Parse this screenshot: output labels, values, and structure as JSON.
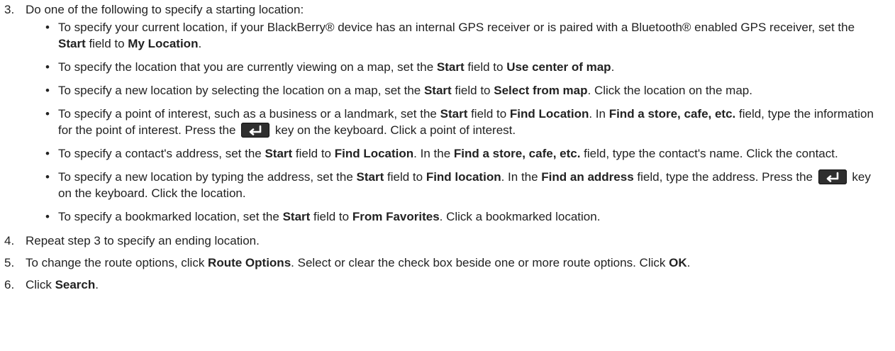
{
  "step3": {
    "number": "3.",
    "text": "Do one of the following to specify a starting location:",
    "bullets": [
      {
        "p1": "To specify your current location, if your BlackBerry® device has an internal GPS receiver or is paired with a Bluetooth® enabled GPS receiver, set the ",
        "b1": "Start",
        "p2": " field to ",
        "b2": "My Location",
        "p3": "."
      },
      {
        "p1": "To specify the location that you are currently viewing on a map, set the ",
        "b1": "Start",
        "p2": " field to ",
        "b2": "Use center of map",
        "p3": "."
      },
      {
        "p1": "To specify a new location by selecting the location on a map, set the ",
        "b1": "Start",
        "p2": " field to ",
        "b2": "Select from map",
        "p3": ". Click the location on the map."
      },
      {
        "p1": "To specify a point of interest, such as a business or a landmark, set the ",
        "b1": "Start",
        "p2": " field to ",
        "b2": "Find Location",
        "p3": ". In ",
        "b3": "Find a store, cafe, etc.",
        "p4": " field, type the information for the point of interest. Press the ",
        "p5": " key on the keyboard. Click a point of interest."
      },
      {
        "p1": "To specify a contact's address, set the ",
        "b1": "Start",
        "p2": " field to ",
        "b2": "Find Location",
        "p3": ". In the ",
        "b3": "Find a store, cafe, etc.",
        "p4": " field, type the contact's name. Click the contact."
      },
      {
        "p1": "To specify a new location by typing the address, set the ",
        "b1": "Start",
        "p2": " field to ",
        "b2": "Find location",
        "p3": ". In the ",
        "b3": "Find an address",
        "p4": " field, type the address. Press the ",
        "p5": " key on the keyboard. Click the location."
      },
      {
        "p1": "To specify a bookmarked location, set the ",
        "b1": "Start",
        "p2": " field to ",
        "b2": "From Favorites",
        "p3": ". Click a bookmarked location."
      }
    ]
  },
  "step4": {
    "number": "4.",
    "text": "Repeat step 3 to specify an ending location."
  },
  "step5": {
    "number": "5.",
    "p1": "To change the route options, click ",
    "b1": "Route Options",
    "p2": ". Select or clear the check box beside one or more route options. Click ",
    "b2": "OK",
    "p3": "."
  },
  "step6": {
    "number": "6.",
    "p1": "Click ",
    "b1": "Search",
    "p2": "."
  },
  "bullet_glyph": "•",
  "icons": {
    "key": "enter-key-icon"
  }
}
